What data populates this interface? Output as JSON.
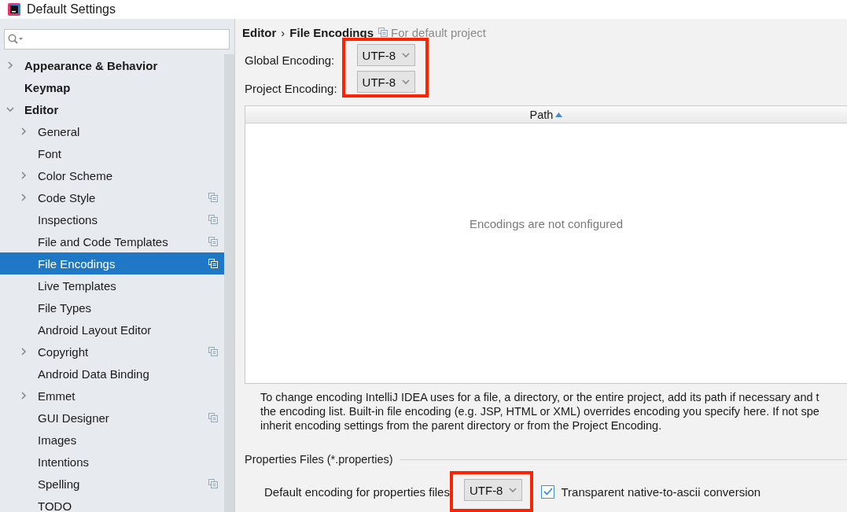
{
  "window": {
    "title": "Default Settings"
  },
  "sidebar": {
    "items": [
      {
        "label": "Appearance & Behavior",
        "bold": true,
        "expanded": false,
        "has_children": true,
        "scoped": false,
        "selected": false
      },
      {
        "label": "Keymap",
        "bold": true,
        "has_children": false,
        "scoped": false,
        "selected": false
      },
      {
        "label": "Editor",
        "bold": true,
        "expanded": true,
        "has_children": true,
        "scoped": false,
        "selected": false,
        "children": [
          {
            "label": "General",
            "has_children": true,
            "expanded": false,
            "scoped": false,
            "selected": false
          },
          {
            "label": "Font",
            "has_children": false,
            "scoped": false,
            "selected": false
          },
          {
            "label": "Color Scheme",
            "has_children": true,
            "expanded": false,
            "scoped": false,
            "selected": false
          },
          {
            "label": "Code Style",
            "has_children": true,
            "expanded": false,
            "scoped": true,
            "selected": false
          },
          {
            "label": "Inspections",
            "has_children": false,
            "scoped": true,
            "selected": false
          },
          {
            "label": "File and Code Templates",
            "has_children": false,
            "scoped": true,
            "selected": false
          },
          {
            "label": "File Encodings",
            "has_children": false,
            "scoped": true,
            "selected": true
          },
          {
            "label": "Live Templates",
            "has_children": false,
            "scoped": false,
            "selected": false
          },
          {
            "label": "File Types",
            "has_children": false,
            "scoped": false,
            "selected": false
          },
          {
            "label": "Android Layout Editor",
            "has_children": false,
            "scoped": false,
            "selected": false
          },
          {
            "label": "Copyright",
            "has_children": true,
            "expanded": false,
            "scoped": true,
            "selected": false
          },
          {
            "label": "Android Data Binding",
            "has_children": false,
            "scoped": false,
            "selected": false
          },
          {
            "label": "Emmet",
            "has_children": true,
            "expanded": false,
            "scoped": false,
            "selected": false
          },
          {
            "label": "GUI Designer",
            "has_children": false,
            "scoped": true,
            "selected": false
          },
          {
            "label": "Images",
            "has_children": false,
            "scoped": false,
            "selected": false
          },
          {
            "label": "Intentions",
            "has_children": false,
            "scoped": false,
            "selected": false
          },
          {
            "label": "Spelling",
            "has_children": false,
            "scoped": true,
            "selected": false
          },
          {
            "label": "TODO",
            "has_children": false,
            "scoped": false,
            "selected": false
          }
        ]
      }
    ]
  },
  "breadcrumb": {
    "parent": "Editor",
    "separator": "›",
    "current": "File Encodings",
    "scope": "For default project"
  },
  "encodings": {
    "highlighted": true,
    "rows": [
      {
        "label": "Global Encoding:",
        "value": "UTF-8"
      },
      {
        "label": "Project Encoding:",
        "value": "UTF-8"
      }
    ]
  },
  "table": {
    "columns": [
      {
        "label": "Path",
        "sorted": true
      }
    ],
    "empty_text": "Encodings are not configured"
  },
  "help_lines": [
    "To change encoding IntelliJ IDEA uses for a file, a directory, or the entire project, add its path if necessary and t",
    "the encoding list. Built-in file encoding (e.g. JSP, HTML or XML) overrides encoding you specify here. If not spe",
    "inherit encoding settings from the parent directory or from the Project Encoding."
  ],
  "properties": {
    "title": "Properties Files (*.properties)",
    "label": "Default encoding for properties files",
    "value": "UTF-8",
    "highlighted": true,
    "transparent": {
      "label": "Transparent native-to-ascii conversion",
      "checked": true
    }
  }
}
